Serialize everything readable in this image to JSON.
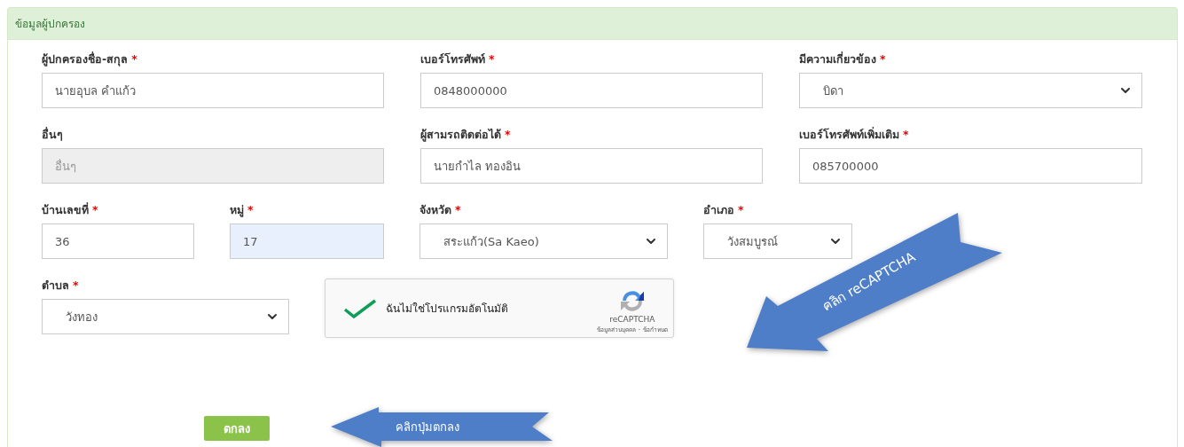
{
  "panel": {
    "title": "ข้อมูลผู้ปกครอง"
  },
  "rows": [
    [
      {
        "label": "ผู้ปกครองชื่อ-สกุล",
        "mark": "*",
        "kind": "text",
        "value": "นายอุบล คำแก้ว",
        "disabled": false,
        "highlighted": false
      },
      {
        "label": "เบอร์โทรศัพท์",
        "mark": "*",
        "kind": "text",
        "value": "0848000000",
        "disabled": false,
        "highlighted": false
      },
      {
        "label": "มีความเกี่ยวข้อง",
        "mark": "*",
        "kind": "select",
        "value": "บิดา",
        "disabled": false,
        "highlighted": false
      }
    ],
    [
      {
        "label": "อื่นๆ",
        "kind": "text",
        "placeholder": "อื่นๆ",
        "disabled": true,
        "highlighted": false
      },
      {
        "label": "ผู้สามรถติดต่อได้",
        "mark": "*",
        "kind": "text",
        "value": "นายกำไล ทองอิน",
        "disabled": false,
        "highlighted": false
      },
      {
        "label": "เบอร์โทรศัพท์เพิ่มเติม",
        "mark": "*",
        "kind": "text",
        "value": "085700000",
        "disabled": false,
        "highlighted": false
      }
    ],
    [
      {
        "label": "บ้านเลขที่",
        "mark": "*",
        "kind": "text",
        "value": "36",
        "disabled": false,
        "highlighted": false
      },
      {
        "label": "หมู่",
        "mark": "*",
        "kind": "text",
        "value": "17",
        "disabled": false,
        "highlighted": true
      },
      {
        "label": "จังหวัด",
        "mark": "*",
        "kind": "select",
        "value": "สระแก้ว(Sa Kaeo)",
        "disabled": false,
        "highlighted": false
      },
      {
        "label": "อำเภอ",
        "mark": "*",
        "kind": "select",
        "value": "วังสมบูรณ์",
        "disabled": false,
        "highlighted": false
      }
    ],
    [
      {
        "label": "ตำบล",
        "mark": "*",
        "kind": "select",
        "value": "วังทอง",
        "disabled": false,
        "highlighted": false
      }
    ]
  ],
  "captcha": {
    "checked": true,
    "label": "ฉันไม่ใช่โปรแกรมอัตโนมัติ",
    "brand": "reCAPTCHA",
    "privacy": "ข้อมูลส่วนบุคคล",
    "separator": "-",
    "terms": "ข้อกำหนด"
  },
  "submit": "ตกลง",
  "annotations": [
    {
      "kind": "diagonal",
      "text": "คลิก reCAPTCHA"
    },
    {
      "kind": "left",
      "text": "คลิกปุ่มตกลง"
    }
  ]
}
